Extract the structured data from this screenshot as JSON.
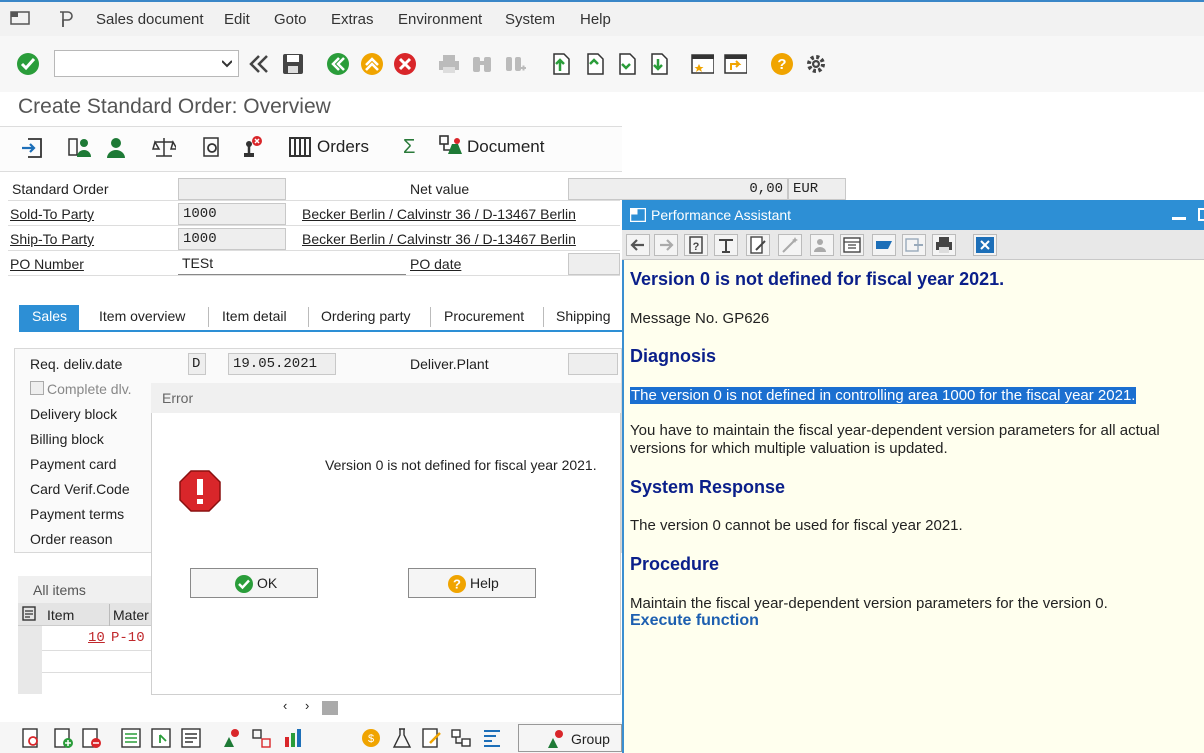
{
  "menubar": {
    "items": [
      "Sales document",
      "Edit",
      "Goto",
      "Extras",
      "Environment",
      "System",
      "Help"
    ]
  },
  "screen_title": "Create Standard Order: Overview",
  "app_toolbar": {
    "orders": "Orders",
    "document": "Document"
  },
  "header": {
    "order_type_label": "Standard Order",
    "net_value_label": "Net value",
    "net_value": "0,00",
    "currency": "EUR",
    "sold_to_label": "Sold-To Party",
    "sold_to": "1000",
    "sold_to_addr": "Becker Berlin / Calvinstr 36 / D-13467 Berlin",
    "ship_to_label": "Ship-To Party",
    "ship_to": "1000",
    "ship_to_addr": "Becker Berlin / Calvinstr 36 / D-13467 Berlin",
    "po_number_label": "PO Number",
    "po_number": "TESt",
    "po_date_label": "PO date"
  },
  "tabs": [
    "Sales",
    "Item overview",
    "Item detail",
    "Ordering party",
    "Procurement",
    "Shipping"
  ],
  "sales": {
    "req_deliv_label": "Req. deliv.date",
    "req_deliv_type": "D",
    "req_deliv_date": "19.05.2021",
    "deliver_plant_label": "Deliver.Plant",
    "complete_dlv_label": "Complete dlv.",
    "delivery_block_label": "Delivery block",
    "billing_block_label": "Billing block",
    "payment_card_label": "Payment card",
    "card_verif_label": "Card Verif.Code",
    "payment_terms_label": "Payment terms",
    "order_reason_label": "Order reason"
  },
  "items": {
    "title": "All items",
    "col_item": "Item",
    "col_material": "Mater",
    "row_item": "10",
    "row_material": "P-10"
  },
  "bottom": {
    "group": "Group"
  },
  "error_dialog": {
    "title": "Error",
    "message": "Version 0 is not defined for fiscal year 2021.",
    "ok": "OK",
    "help": "Help"
  },
  "performance_assistant": {
    "title": "Performance Assistant",
    "heading": "Version 0 is not defined for fiscal year 2021.",
    "message_no": "Message No. GP626",
    "diagnosis_h": "Diagnosis",
    "diagnosis_sel": "The version 0 is not defined in controlling area 1000 for the fiscal year 2021.",
    "diagnosis_l1": "You have to maintain the fiscal year-dependent version parameters for all actual",
    "diagnosis_l2": "versions for which multiple valuation is updated.",
    "response_h": "System Response",
    "response": "The version 0 cannot be used for fiscal year 2021.",
    "procedure_h": "Procedure",
    "procedure": "Maintain the fiscal year-dependent version parameters for the version 0.",
    "execute": "Execute function"
  },
  "colors": {
    "accent": "#2d8fd5",
    "error_red": "#d9262a",
    "ok_green": "#2a9d3a",
    "help_orange": "#f0a400"
  }
}
